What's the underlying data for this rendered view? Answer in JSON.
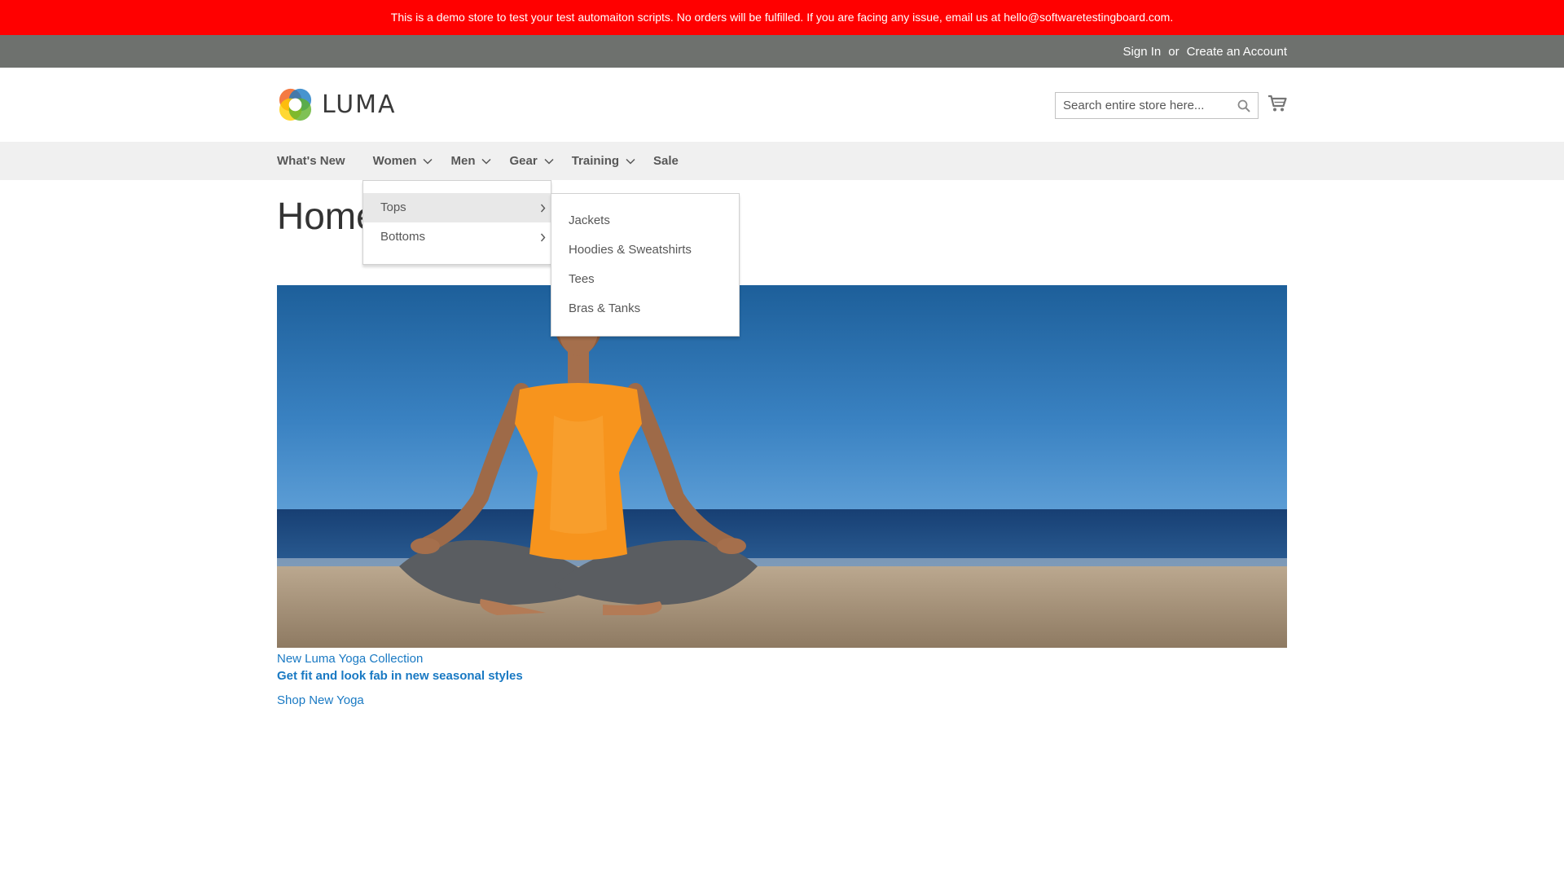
{
  "notice": {
    "text": "This is a demo store to test your test automaiton scripts. No orders will be fulfilled. If you are facing any issue, email us at hello@softwaretestingboard.com."
  },
  "panel": {
    "sign_in": "Sign In",
    "or": "or",
    "create_account": "Create an Account"
  },
  "header": {
    "logo_text": "LUMA",
    "search_placeholder": "Search entire store here...",
    "search_value": ""
  },
  "nav": {
    "items": [
      {
        "label": "What's New"
      },
      {
        "label": "Women"
      },
      {
        "label": "Men"
      },
      {
        "label": "Gear"
      },
      {
        "label": "Training"
      },
      {
        "label": "Sale"
      }
    ]
  },
  "page": {
    "title": "Home Page"
  },
  "dropdown": {
    "level1": [
      {
        "label": "Tops"
      },
      {
        "label": "Bottoms"
      }
    ],
    "level2": [
      {
        "label": "Jackets"
      },
      {
        "label": "Hoodies & Sweatshirts"
      },
      {
        "label": "Tees"
      },
      {
        "label": "Bras & Tanks"
      }
    ]
  },
  "promo": {
    "sub": "New Luma Yoga Collection",
    "headline": "Get fit and look fab in new seasonal styles",
    "shop_link": "Shop New Yoga"
  },
  "colors": {
    "notice_bg": "#ff0000",
    "panel_bg": "#6e716e",
    "nav_bg": "#f0f0f0",
    "link": "#1979c3"
  }
}
